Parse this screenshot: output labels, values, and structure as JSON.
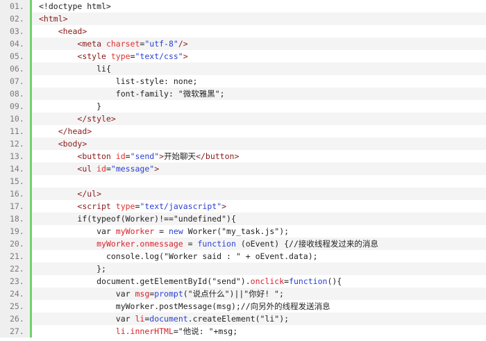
{
  "colors": {
    "gutter_bg": "#efefef",
    "gutter_border": "#6ed36a",
    "stripe": "#f4f4f4",
    "tag": "#8a1a1a",
    "attr": "#e0302e",
    "string": "#2a3fd4",
    "ident": "#d8202a"
  },
  "lines": [
    {
      "num": "01.",
      "indent": 0,
      "tokens": [
        {
          "t": "text",
          "v": "<!doctype html>"
        }
      ]
    },
    {
      "num": "02.",
      "indent": 0,
      "tokens": [
        {
          "t": "tag",
          "v": "<html>"
        }
      ]
    },
    {
      "num": "03.",
      "indent": 1,
      "tokens": [
        {
          "t": "tag",
          "v": "<head>"
        }
      ]
    },
    {
      "num": "04.",
      "indent": 2,
      "tokens": [
        {
          "t": "tag",
          "v": "<meta "
        },
        {
          "t": "attr",
          "v": "charset"
        },
        {
          "t": "text",
          "v": "="
        },
        {
          "t": "str",
          "v": "\"utf-8\""
        },
        {
          "t": "tag",
          "v": "/>"
        }
      ]
    },
    {
      "num": "05.",
      "indent": 2,
      "tokens": [
        {
          "t": "tag",
          "v": "<style "
        },
        {
          "t": "attr",
          "v": "type"
        },
        {
          "t": "text",
          "v": "="
        },
        {
          "t": "str",
          "v": "\"text/css\""
        },
        {
          "t": "tag",
          "v": ">"
        }
      ]
    },
    {
      "num": "06.",
      "indent": 3,
      "tokens": [
        {
          "t": "text",
          "v": "li{"
        }
      ]
    },
    {
      "num": "07.",
      "indent": 4,
      "tokens": [
        {
          "t": "text",
          "v": "list-style: none;"
        }
      ]
    },
    {
      "num": "08.",
      "indent": 4,
      "tokens": [
        {
          "t": "text",
          "v": "font-family: \"微软雅黑\";"
        }
      ]
    },
    {
      "num": "09.",
      "indent": 3,
      "tokens": [
        {
          "t": "text",
          "v": "}"
        }
      ]
    },
    {
      "num": "10.",
      "indent": 2,
      "tokens": [
        {
          "t": "tag",
          "v": "</style>"
        }
      ]
    },
    {
      "num": "11.",
      "indent": 1,
      "tokens": [
        {
          "t": "tag",
          "v": "</head>"
        }
      ]
    },
    {
      "num": "12.",
      "indent": 1,
      "tokens": [
        {
          "t": "tag",
          "v": "<body>"
        }
      ]
    },
    {
      "num": "13.",
      "indent": 2,
      "tokens": [
        {
          "t": "tag",
          "v": "<button "
        },
        {
          "t": "attr",
          "v": "id"
        },
        {
          "t": "text",
          "v": "="
        },
        {
          "t": "str",
          "v": "\"send\""
        },
        {
          "t": "tag",
          "v": ">"
        },
        {
          "t": "text",
          "v": "开始聊天"
        },
        {
          "t": "tag",
          "v": "</button>"
        }
      ]
    },
    {
      "num": "14.",
      "indent": 2,
      "tokens": [
        {
          "t": "tag",
          "v": "<ul "
        },
        {
          "t": "attr",
          "v": "id"
        },
        {
          "t": "text",
          "v": "="
        },
        {
          "t": "str",
          "v": "\"message\""
        },
        {
          "t": "tag",
          "v": ">"
        }
      ]
    },
    {
      "num": "15.",
      "indent": 0,
      "tokens": []
    },
    {
      "num": "16.",
      "indent": 2,
      "tokens": [
        {
          "t": "tag",
          "v": "</ul>"
        }
      ]
    },
    {
      "num": "17.",
      "indent": 2,
      "tokens": [
        {
          "t": "tag",
          "v": "<script "
        },
        {
          "t": "attr",
          "v": "type"
        },
        {
          "t": "text",
          "v": "="
        },
        {
          "t": "str",
          "v": "\"text/javascript\""
        },
        {
          "t": "tag",
          "v": ">"
        }
      ]
    },
    {
      "num": "18.",
      "indent": 2,
      "tokens": [
        {
          "t": "text",
          "v": "if(typeof(Worker)!==\"undefined\"){"
        }
      ]
    },
    {
      "num": "19.",
      "indent": 3,
      "tokens": [
        {
          "t": "text",
          "v": "var "
        },
        {
          "t": "ident",
          "v": "myWorker"
        },
        {
          "t": "text",
          "v": " = "
        },
        {
          "t": "kw",
          "v": "new"
        },
        {
          "t": "text",
          "v": " Worker(\"my_task.js\");"
        }
      ]
    },
    {
      "num": "20.",
      "indent": 3,
      "tokens": [
        {
          "t": "ident",
          "v": "myWorker.onmessage"
        },
        {
          "t": "text",
          "v": " = "
        },
        {
          "t": "kw",
          "v": "function"
        },
        {
          "t": "text",
          "v": " (oEvent) {//接收线程发过来的消息"
        }
      ]
    },
    {
      "num": "21.",
      "indent": 3,
      "extra": "  ",
      "tokens": [
        {
          "t": "text",
          "v": "console.log(\"Worker said : \" + oEvent.data);"
        }
      ]
    },
    {
      "num": "22.",
      "indent": 3,
      "tokens": [
        {
          "t": "text",
          "v": "};"
        }
      ]
    },
    {
      "num": "23.",
      "indent": 3,
      "tokens": [
        {
          "t": "text",
          "v": "document.getElementById(\"send\")."
        },
        {
          "t": "ident",
          "v": "onclick"
        },
        {
          "t": "text",
          "v": "="
        },
        {
          "t": "kw",
          "v": "function"
        },
        {
          "t": "text",
          "v": "(){"
        }
      ]
    },
    {
      "num": "24.",
      "indent": 4,
      "tokens": [
        {
          "t": "text",
          "v": "var "
        },
        {
          "t": "ident",
          "v": "msg"
        },
        {
          "t": "text",
          "v": "="
        },
        {
          "t": "kw",
          "v": "prompt"
        },
        {
          "t": "text",
          "v": "(\"说点什么\")||\"你好! \";"
        }
      ]
    },
    {
      "num": "25.",
      "indent": 4,
      "tokens": [
        {
          "t": "text",
          "v": "myWorker.postMessage(msg);//向另外的线程发送消息"
        }
      ]
    },
    {
      "num": "26.",
      "indent": 4,
      "tokens": [
        {
          "t": "text",
          "v": "var "
        },
        {
          "t": "ident",
          "v": "li"
        },
        {
          "t": "text",
          "v": "="
        },
        {
          "t": "kw",
          "v": "document"
        },
        {
          "t": "text",
          "v": ".createElement(\"li\");"
        }
      ]
    },
    {
      "num": "27.",
      "indent": 4,
      "tokens": [
        {
          "t": "ident",
          "v": "li.innerHTML"
        },
        {
          "t": "text",
          "v": "=\""
        },
        {
          "t": "text",
          "v": "他说: \"+msg;"
        }
      ]
    }
  ]
}
